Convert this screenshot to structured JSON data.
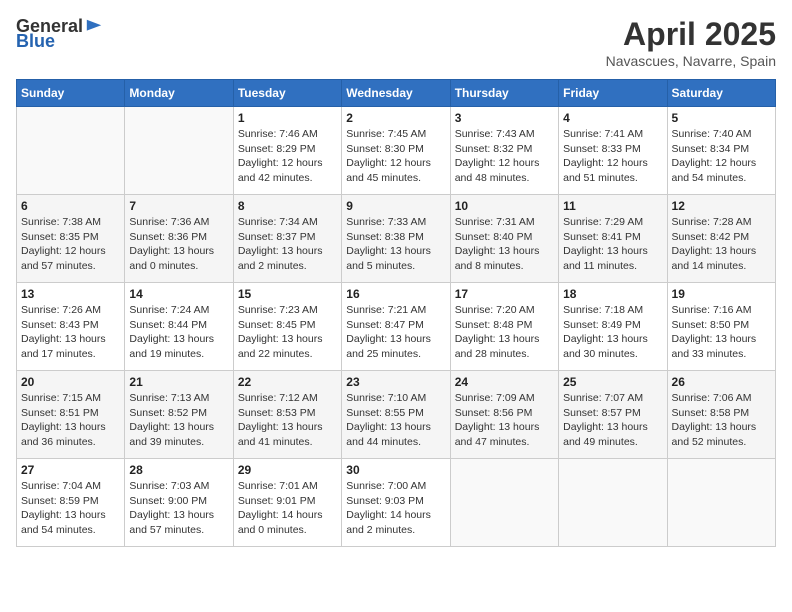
{
  "header": {
    "logo_general": "General",
    "logo_blue": "Blue",
    "title": "April 2025",
    "location": "Navascues, Navarre, Spain"
  },
  "weekdays": [
    "Sunday",
    "Monday",
    "Tuesday",
    "Wednesday",
    "Thursday",
    "Friday",
    "Saturday"
  ],
  "rows": [
    [
      {
        "day": "",
        "info": ""
      },
      {
        "day": "",
        "info": ""
      },
      {
        "day": "1",
        "info": "Sunrise: 7:46 AM\nSunset: 8:29 PM\nDaylight: 12 hours\nand 42 minutes."
      },
      {
        "day": "2",
        "info": "Sunrise: 7:45 AM\nSunset: 8:30 PM\nDaylight: 12 hours\nand 45 minutes."
      },
      {
        "day": "3",
        "info": "Sunrise: 7:43 AM\nSunset: 8:32 PM\nDaylight: 12 hours\nand 48 minutes."
      },
      {
        "day": "4",
        "info": "Sunrise: 7:41 AM\nSunset: 8:33 PM\nDaylight: 12 hours\nand 51 minutes."
      },
      {
        "day": "5",
        "info": "Sunrise: 7:40 AM\nSunset: 8:34 PM\nDaylight: 12 hours\nand 54 minutes."
      }
    ],
    [
      {
        "day": "6",
        "info": "Sunrise: 7:38 AM\nSunset: 8:35 PM\nDaylight: 12 hours\nand 57 minutes."
      },
      {
        "day": "7",
        "info": "Sunrise: 7:36 AM\nSunset: 8:36 PM\nDaylight: 13 hours\nand 0 minutes."
      },
      {
        "day": "8",
        "info": "Sunrise: 7:34 AM\nSunset: 8:37 PM\nDaylight: 13 hours\nand 2 minutes."
      },
      {
        "day": "9",
        "info": "Sunrise: 7:33 AM\nSunset: 8:38 PM\nDaylight: 13 hours\nand 5 minutes."
      },
      {
        "day": "10",
        "info": "Sunrise: 7:31 AM\nSunset: 8:40 PM\nDaylight: 13 hours\nand 8 minutes."
      },
      {
        "day": "11",
        "info": "Sunrise: 7:29 AM\nSunset: 8:41 PM\nDaylight: 13 hours\nand 11 minutes."
      },
      {
        "day": "12",
        "info": "Sunrise: 7:28 AM\nSunset: 8:42 PM\nDaylight: 13 hours\nand 14 minutes."
      }
    ],
    [
      {
        "day": "13",
        "info": "Sunrise: 7:26 AM\nSunset: 8:43 PM\nDaylight: 13 hours\nand 17 minutes."
      },
      {
        "day": "14",
        "info": "Sunrise: 7:24 AM\nSunset: 8:44 PM\nDaylight: 13 hours\nand 19 minutes."
      },
      {
        "day": "15",
        "info": "Sunrise: 7:23 AM\nSunset: 8:45 PM\nDaylight: 13 hours\nand 22 minutes."
      },
      {
        "day": "16",
        "info": "Sunrise: 7:21 AM\nSunset: 8:47 PM\nDaylight: 13 hours\nand 25 minutes."
      },
      {
        "day": "17",
        "info": "Sunrise: 7:20 AM\nSunset: 8:48 PM\nDaylight: 13 hours\nand 28 minutes."
      },
      {
        "day": "18",
        "info": "Sunrise: 7:18 AM\nSunset: 8:49 PM\nDaylight: 13 hours\nand 30 minutes."
      },
      {
        "day": "19",
        "info": "Sunrise: 7:16 AM\nSunset: 8:50 PM\nDaylight: 13 hours\nand 33 minutes."
      }
    ],
    [
      {
        "day": "20",
        "info": "Sunrise: 7:15 AM\nSunset: 8:51 PM\nDaylight: 13 hours\nand 36 minutes."
      },
      {
        "day": "21",
        "info": "Sunrise: 7:13 AM\nSunset: 8:52 PM\nDaylight: 13 hours\nand 39 minutes."
      },
      {
        "day": "22",
        "info": "Sunrise: 7:12 AM\nSunset: 8:53 PM\nDaylight: 13 hours\nand 41 minutes."
      },
      {
        "day": "23",
        "info": "Sunrise: 7:10 AM\nSunset: 8:55 PM\nDaylight: 13 hours\nand 44 minutes."
      },
      {
        "day": "24",
        "info": "Sunrise: 7:09 AM\nSunset: 8:56 PM\nDaylight: 13 hours\nand 47 minutes."
      },
      {
        "day": "25",
        "info": "Sunrise: 7:07 AM\nSunset: 8:57 PM\nDaylight: 13 hours\nand 49 minutes."
      },
      {
        "day": "26",
        "info": "Sunrise: 7:06 AM\nSunset: 8:58 PM\nDaylight: 13 hours\nand 52 minutes."
      }
    ],
    [
      {
        "day": "27",
        "info": "Sunrise: 7:04 AM\nSunset: 8:59 PM\nDaylight: 13 hours\nand 54 minutes."
      },
      {
        "day": "28",
        "info": "Sunrise: 7:03 AM\nSunset: 9:00 PM\nDaylight: 13 hours\nand 57 minutes."
      },
      {
        "day": "29",
        "info": "Sunrise: 7:01 AM\nSunset: 9:01 PM\nDaylight: 14 hours\nand 0 minutes."
      },
      {
        "day": "30",
        "info": "Sunrise: 7:00 AM\nSunset: 9:03 PM\nDaylight: 14 hours\nand 2 minutes."
      },
      {
        "day": "",
        "info": ""
      },
      {
        "day": "",
        "info": ""
      },
      {
        "day": "",
        "info": ""
      }
    ]
  ]
}
